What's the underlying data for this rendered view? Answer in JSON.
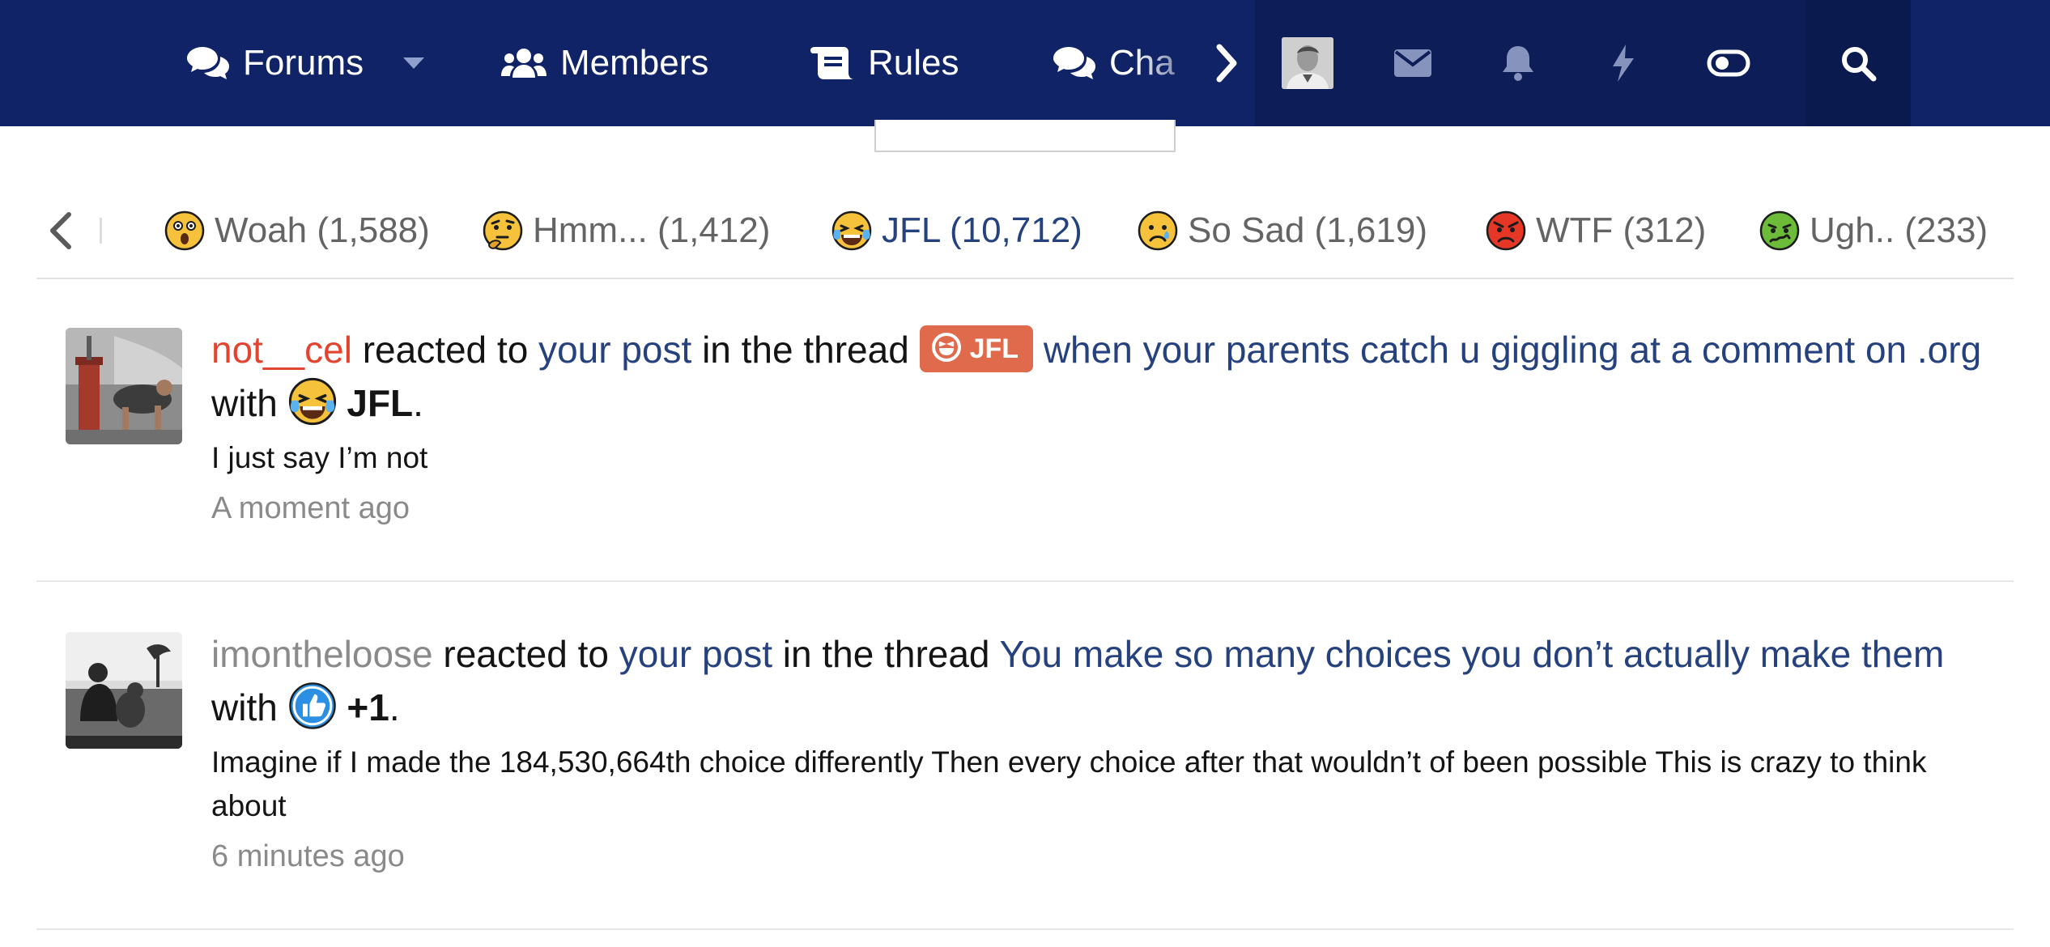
{
  "nav": {
    "items": [
      {
        "label": "Forums",
        "icon": "comments-icon"
      },
      {
        "label": "Members",
        "icon": "users-icon"
      },
      {
        "label": "Rules",
        "icon": "scroll-icon"
      },
      {
        "label": "Cha",
        "icon": "comments-icon"
      }
    ],
    "right_icons": [
      "user-avatar",
      "envelope-icon",
      "bell-icon",
      "bolt-icon",
      "toggle-icon",
      "search-icon"
    ],
    "colors": {
      "bar": "#0f2366",
      "bar_right": "#0c1d57"
    }
  },
  "reactions": {
    "tabs": [
      {
        "label": "Woah (1,588)",
        "icon": "woah-emoji"
      },
      {
        "label": "Hmm... (1,412)",
        "icon": "thinking-emoji"
      },
      {
        "label": "JFL (10,712)",
        "icon": "laughing-crying-emoji",
        "active": true
      },
      {
        "label": "So Sad (1,619)",
        "icon": "crying-emoji"
      },
      {
        "label": "WTF (312)",
        "icon": "angry-emoji"
      },
      {
        "label": "Ugh.. (233)",
        "icon": "sick-emoji"
      }
    ]
  },
  "alerts": [
    {
      "user": "not__cel",
      "reacted_to": "reacted to",
      "your_post": "your post",
      "in_thread": "in the thread",
      "prefix": "JFL",
      "thread": "when your parents catch u giggling at a comment on .org",
      "with": "with",
      "reaction": "JFL",
      "period": ".",
      "snippet": "I just say I’m not",
      "time": "A moment ago"
    },
    {
      "user": "imontheloose",
      "reacted_to": "reacted to",
      "your_post": "your post",
      "in_thread": "in the thread",
      "thread": "You make so many choices you don’t actually make them",
      "with": "with",
      "reaction": "+1",
      "period": ".",
      "snippet": "Imagine if I made the 184,530,664th choice differently Then every choice after that wouldn’t of been possible This is crazy to think about",
      "time": "6 minutes ago"
    }
  ]
}
